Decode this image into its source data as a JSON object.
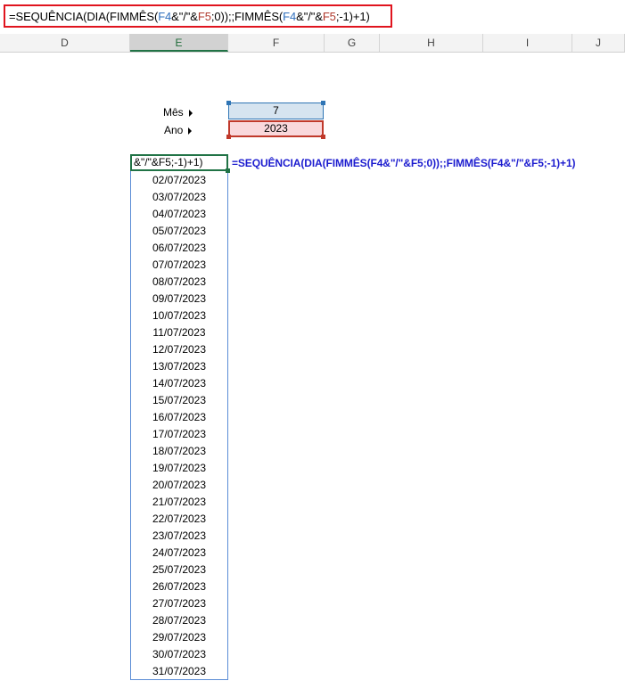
{
  "formula_bar": {
    "formula_parts": [
      {
        "t": "=SEQUÊNCIA(DIA(FIMMÊS(",
        "c": ""
      },
      {
        "t": "F4",
        "c": "blue"
      },
      {
        "t": "&\"/\"&",
        "c": ""
      },
      {
        "t": "F5",
        "c": "red"
      },
      {
        "t": ";0));;FIMMÊS(",
        "c": ""
      },
      {
        "t": "F4",
        "c": "blue"
      },
      {
        "t": "&\"/\"&",
        "c": ""
      },
      {
        "t": "F5",
        "c": "red"
      },
      {
        "t": ";-1)+1)",
        "c": ""
      }
    ]
  },
  "columns": [
    {
      "name": "D",
      "selected": false
    },
    {
      "name": "E",
      "selected": true
    },
    {
      "name": "F",
      "selected": false
    },
    {
      "name": "G",
      "selected": false
    },
    {
      "name": "H",
      "selected": false
    },
    {
      "name": "I",
      "selected": false
    },
    {
      "name": "J",
      "selected": false
    }
  ],
  "inputs": {
    "mes_label": "Mês",
    "mes_value": "7",
    "ano_label": "Ano",
    "ano_value": "2023"
  },
  "active_cell_text": "&\"/\"&F5;-1)+1)",
  "annotation": "=SEQUÊNCIA(DIA(FIMMÊS(F4&\"/\"&F5;0));;FIMMÊS(F4&\"/\"&F5;-1)+1)",
  "dates": [
    "02/07/2023",
    "03/07/2023",
    "04/07/2023",
    "05/07/2023",
    "06/07/2023",
    "07/07/2023",
    "08/07/2023",
    "09/07/2023",
    "10/07/2023",
    "11/07/2023",
    "12/07/2023",
    "13/07/2023",
    "14/07/2023",
    "15/07/2023",
    "16/07/2023",
    "17/07/2023",
    "18/07/2023",
    "19/07/2023",
    "20/07/2023",
    "21/07/2023",
    "22/07/2023",
    "23/07/2023",
    "24/07/2023",
    "25/07/2023",
    "26/07/2023",
    "27/07/2023",
    "28/07/2023",
    "29/07/2023",
    "30/07/2023",
    "31/07/2023"
  ],
  "colors": {
    "accent": "#217346",
    "highlight": "#e0141e",
    "annotation": "#1c1ccf"
  }
}
